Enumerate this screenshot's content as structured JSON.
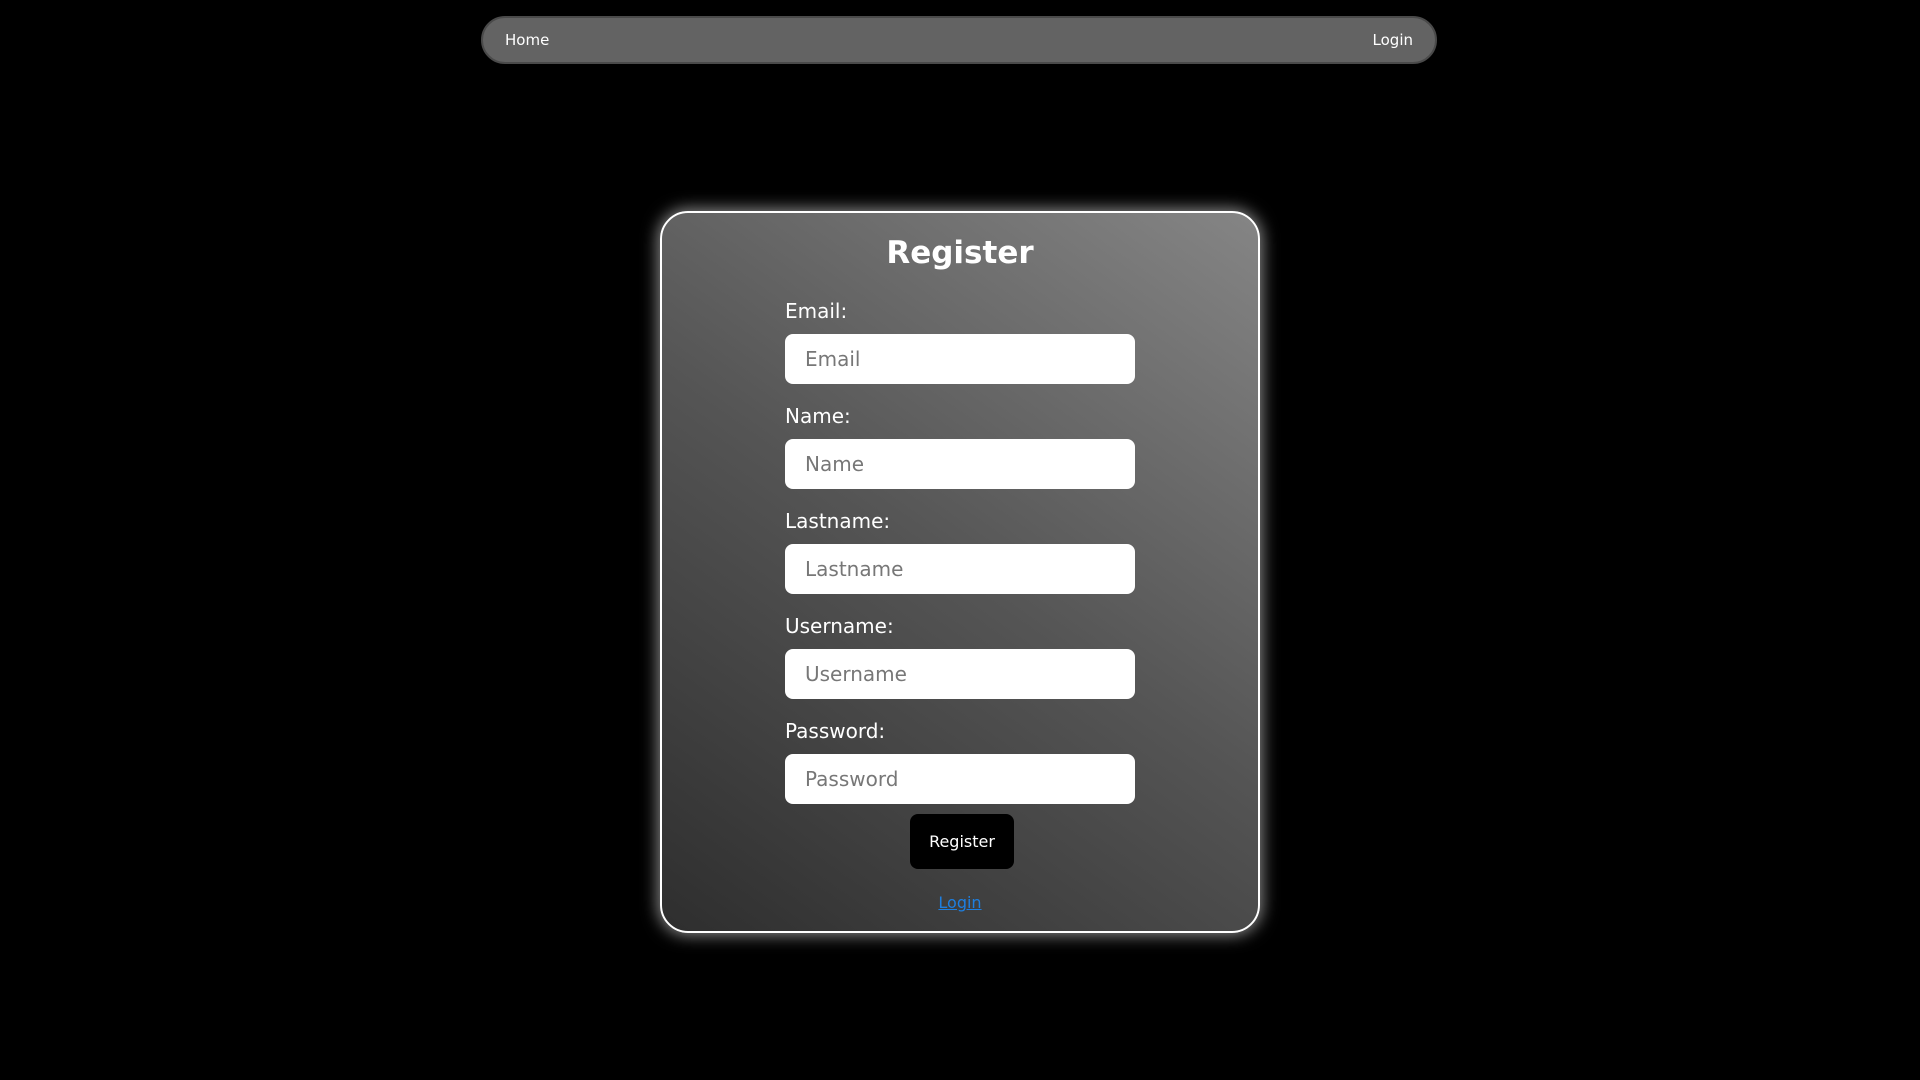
{
  "nav": {
    "home_label": "Home",
    "login_label": "Login"
  },
  "form": {
    "title": "Register",
    "email": {
      "label": "Email:",
      "placeholder": "Email",
      "value": ""
    },
    "name": {
      "label": "Name:",
      "placeholder": "Name",
      "value": ""
    },
    "lastname": {
      "label": "Lastname:",
      "placeholder": "Lastname",
      "value": ""
    },
    "username": {
      "label": "Username:",
      "placeholder": "Username",
      "value": ""
    },
    "password": {
      "label": "Password:",
      "placeholder": "Password",
      "value": ""
    },
    "submit_label": "Register",
    "login_link_label": "Login"
  },
  "colors": {
    "page_background": "#000000",
    "navbar_background": "#636363",
    "card_border": "#ffffff",
    "button_background": "#000000",
    "link_color": "#1e7fe0"
  }
}
